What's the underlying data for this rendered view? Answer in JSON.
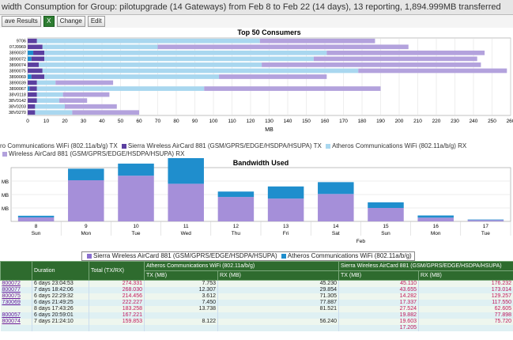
{
  "header": {
    "title": "width Consumption for Group: pilotupgrade (14 Gateways) from Feb 8 to Feb 22 (14 days), 13 reporting, 1,894.999MB transferred"
  },
  "toolbar": {
    "save_label": "ave Results",
    "excel_icon": "excel-icon",
    "change_label": "Change",
    "edit_label": "Edit"
  },
  "colors": {
    "sierra_tx": "#5b3fa0",
    "sierra_rx": "#b3a2dd",
    "atheros_tx": "#1f8ecd",
    "atheros_rx": "#a9d7ef",
    "table_header": "#2e6b2e"
  },
  "legend1": {
    "row1": [
      "ro Communications WiFi (802.11a/b/g) TX",
      "Sierra Wireless AirCard 881 (GSM/GPRS/EDGE/HSDPA/HSUPA) TX",
      "Atheros Communications WiFi (802.11a/b/g) RX"
    ],
    "row2": "Wireless AirCard 881 (GSM/GPRS/EDGE/HSDPA/HSUPA) RX"
  },
  "legend2": {
    "sierra": "Sierra Wireless AirCard 881 (GSM/GPRS/EDGE/HSDPA/HSUPA)",
    "atheros": "Atheros Communications WiFi (802.11a/b/g)"
  },
  "chart_data": [
    {
      "type": "bar",
      "orientation": "horizontal",
      "stacked": true,
      "title": "Top 50 Consumers",
      "xlabel": "MB",
      "xlim": [
        0,
        260
      ],
      "xticks": [
        0,
        10,
        20,
        30,
        40,
        50,
        60,
        70,
        80,
        90,
        100,
        110,
        120,
        130,
        140,
        150,
        160,
        170,
        180,
        190,
        200,
        210,
        220,
        230,
        240,
        250,
        260
      ],
      "categories": [
        "9706",
        "07J0969",
        "3890037",
        "3890072",
        "3890074",
        "3890075",
        "3890069",
        "3890039",
        "3890067",
        "38V0118",
        "38V0142",
        "38V0203",
        "38V0270"
      ],
      "series": [
        {
          "color_key": "atheros_tx",
          "values": [
            0,
            0,
            3,
            2,
            0,
            0,
            2,
            0,
            1,
            0,
            0,
            0,
            0
          ]
        },
        {
          "color_key": "sierra_tx",
          "values": [
            5,
            8,
            6,
            7,
            6,
            8,
            7,
            5,
            4,
            5,
            5,
            4,
            4
          ]
        },
        {
          "color_key": "atheros_rx",
          "values": [
            120,
            62,
            152,
            145,
            120,
            170,
            94,
            10,
            90,
            14,
            12,
            16,
            20
          ]
        },
        {
          "color_key": "sierra_rx",
          "values": [
            62,
            135,
            85,
            88,
            118,
            80,
            58,
            31,
            95,
            25,
            15,
            28,
            36
          ]
        }
      ]
    },
    {
      "type": "bar",
      "stacked": true,
      "title": "Bandwidth Used",
      "ylabel": "MB",
      "xlabel": "Feb",
      "categories": [
        "8",
        "9",
        "10",
        "11",
        "12",
        "13",
        "14",
        "15",
        "16",
        "17"
      ],
      "days": [
        "Sun",
        "Mon",
        "Tue",
        "Wed",
        "Thu",
        "Fri",
        "Sat",
        "Sun",
        "Mon",
        "Tue"
      ],
      "series": [
        {
          "name": "Sierra Wireless AirCard 881 (GSM/GPRS/EDGE/HSDPA/HSUPA)",
          "color_key": "sierra_rx",
          "values": [
            15,
            153,
            170,
            140,
            91,
            85,
            102,
            50,
            14,
            5
          ]
        },
        {
          "name": "Atheros Communications WiFi (802.11a/b/g)",
          "color_key": "atheros_tx",
          "values": [
            6,
            43,
            45,
            100,
            20,
            45,
            44,
            21,
            8,
            2
          ]
        }
      ]
    }
  ],
  "table": {
    "header_top": [
      "",
      "Duration",
      "Total (TX/RX)",
      "Atheros Communications WiFi (802.11a/b/g)",
      "Sierra Wireless AirCard 881 (GSM/GPRS/EDGE/HSDPA/HSUPA)"
    ],
    "header_sub": [
      "TX (MB)",
      "RX (MB)",
      "TX (MB)",
      "RX (MB)"
    ],
    "rows": [
      {
        "id": "800072",
        "duration": "6 days 23:04:53",
        "total": "274.331",
        "a_tx": "7.753",
        "a_rx": "45.230",
        "s_tx": "45.110",
        "s_rx": "176.232"
      },
      {
        "id": "800077",
        "duration": "7 days 18:42:06",
        "total": "268.030",
        "a_tx": "12.307",
        "a_rx": "29.854",
        "s_tx": "43.655",
        "s_rx": "173.014"
      },
      {
        "id": "800075",
        "duration": "6 days 22:29:32",
        "total": "214.456",
        "a_tx": "3.612",
        "a_rx": "71.305",
        "s_tx": "14.282",
        "s_rx": "129.257"
      },
      {
        "id": "730069",
        "duration": "6 days 21:49:25",
        "total": "222.227",
        "a_tx": "7.450",
        "a_rx": "77.887",
        "s_tx": "17.337",
        "s_rx": "117.550"
      },
      {
        "id": "",
        "duration": "8 days 17:43:26",
        "total": "183.258",
        "a_tx": "13.738",
        "a_rx": "81.521",
        "s_tx": "27.524",
        "s_rx": "62.605"
      },
      {
        "id": "800057",
        "duration": "6 days 20:59:01",
        "total": "167.221",
        "a_tx": "",
        "a_rx": "",
        "s_tx": "19.882",
        "s_rx": "77.898"
      },
      {
        "id": "800074",
        "duration": "7 days 21:24:10",
        "total": "159.853",
        "a_tx": "8.122",
        "a_rx": "56.240",
        "s_tx": "19.603",
        "s_rx": "75.720"
      },
      {
        "id": "",
        "duration": "",
        "total": "",
        "a_tx": "",
        "a_rx": "",
        "s_tx": "17.205",
        "s_rx": ""
      }
    ]
  }
}
